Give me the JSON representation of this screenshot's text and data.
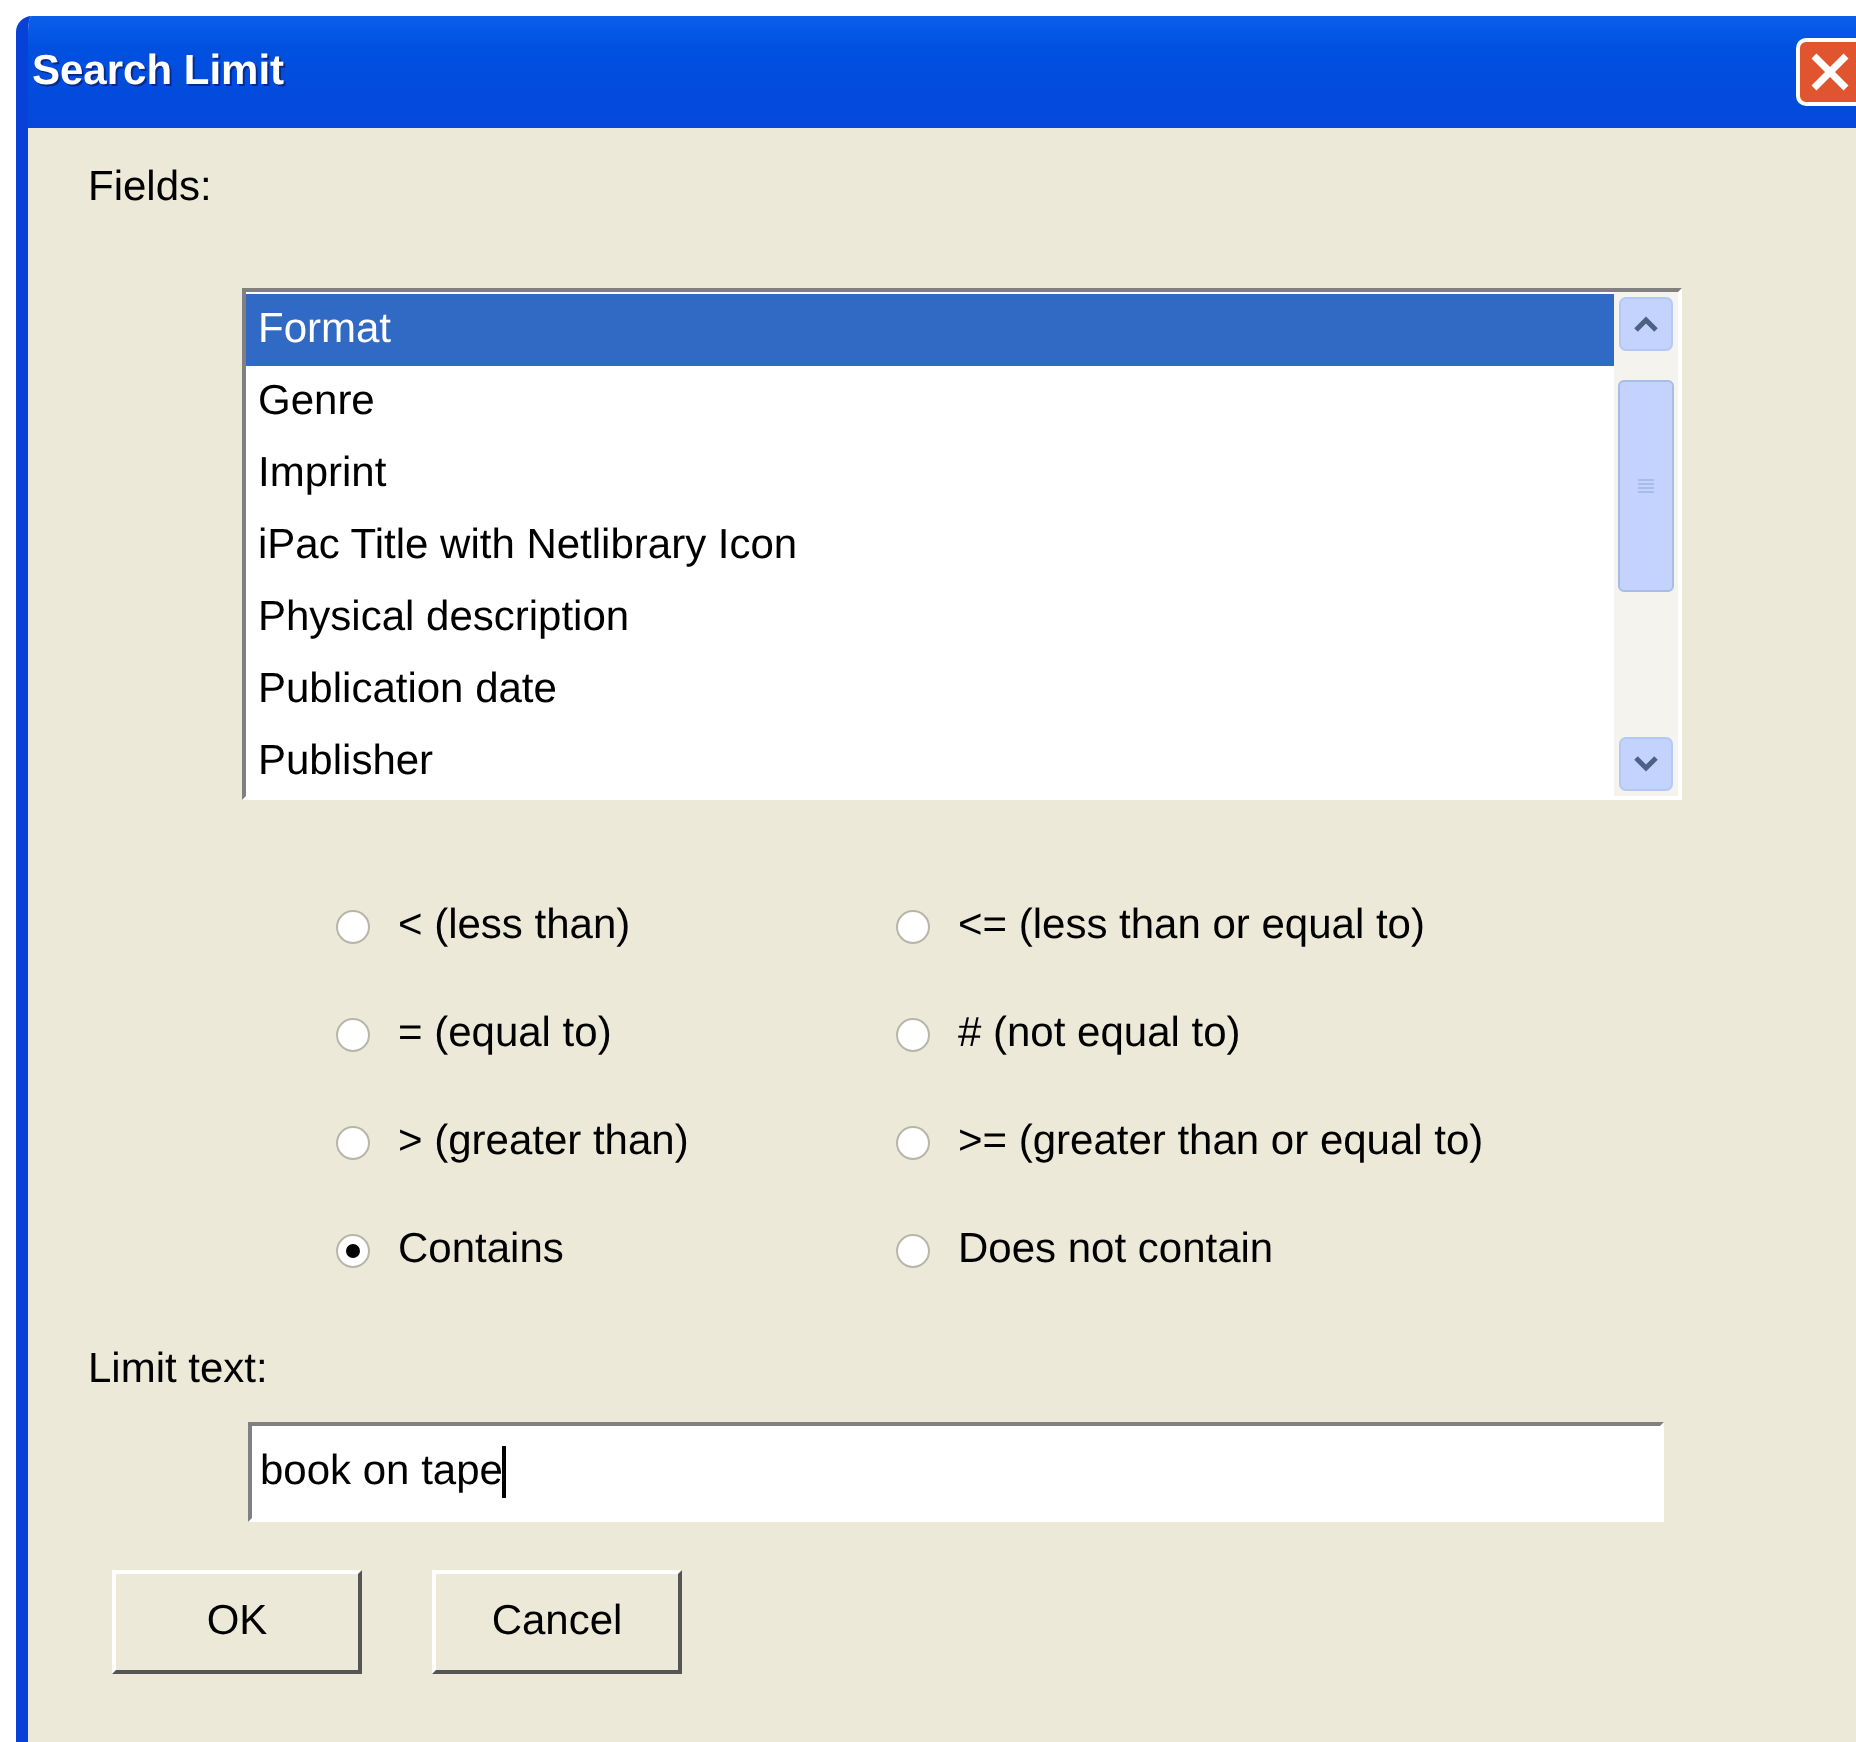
{
  "window": {
    "title": "Search Limit"
  },
  "fields_label": "Fields:",
  "fields": [
    {
      "label": "Format",
      "selected": true
    },
    {
      "label": "Genre",
      "selected": false
    },
    {
      "label": "Imprint",
      "selected": false
    },
    {
      "label": "iPac Title with Netlibrary Icon",
      "selected": false
    },
    {
      "label": "Physical description",
      "selected": false
    },
    {
      "label": "Publication date",
      "selected": false
    },
    {
      "label": "Publisher",
      "selected": false
    }
  ],
  "operators": [
    {
      "label": "< (less than)",
      "selected": false
    },
    {
      "label": "<= (less than or equal to)",
      "selected": false
    },
    {
      "label": "= (equal to)",
      "selected": false
    },
    {
      "label": "# (not equal to)",
      "selected": false
    },
    {
      "label": "> (greater than)",
      "selected": false
    },
    {
      "label": ">= (greater than or equal to)",
      "selected": false
    },
    {
      "label": "Contains",
      "selected": true
    },
    {
      "label": "Does not contain",
      "selected": false
    }
  ],
  "limit_text_label": "Limit text:",
  "limit_text": {
    "value": "book on tape"
  },
  "buttons": [
    "OK",
    "Cancel"
  ]
}
